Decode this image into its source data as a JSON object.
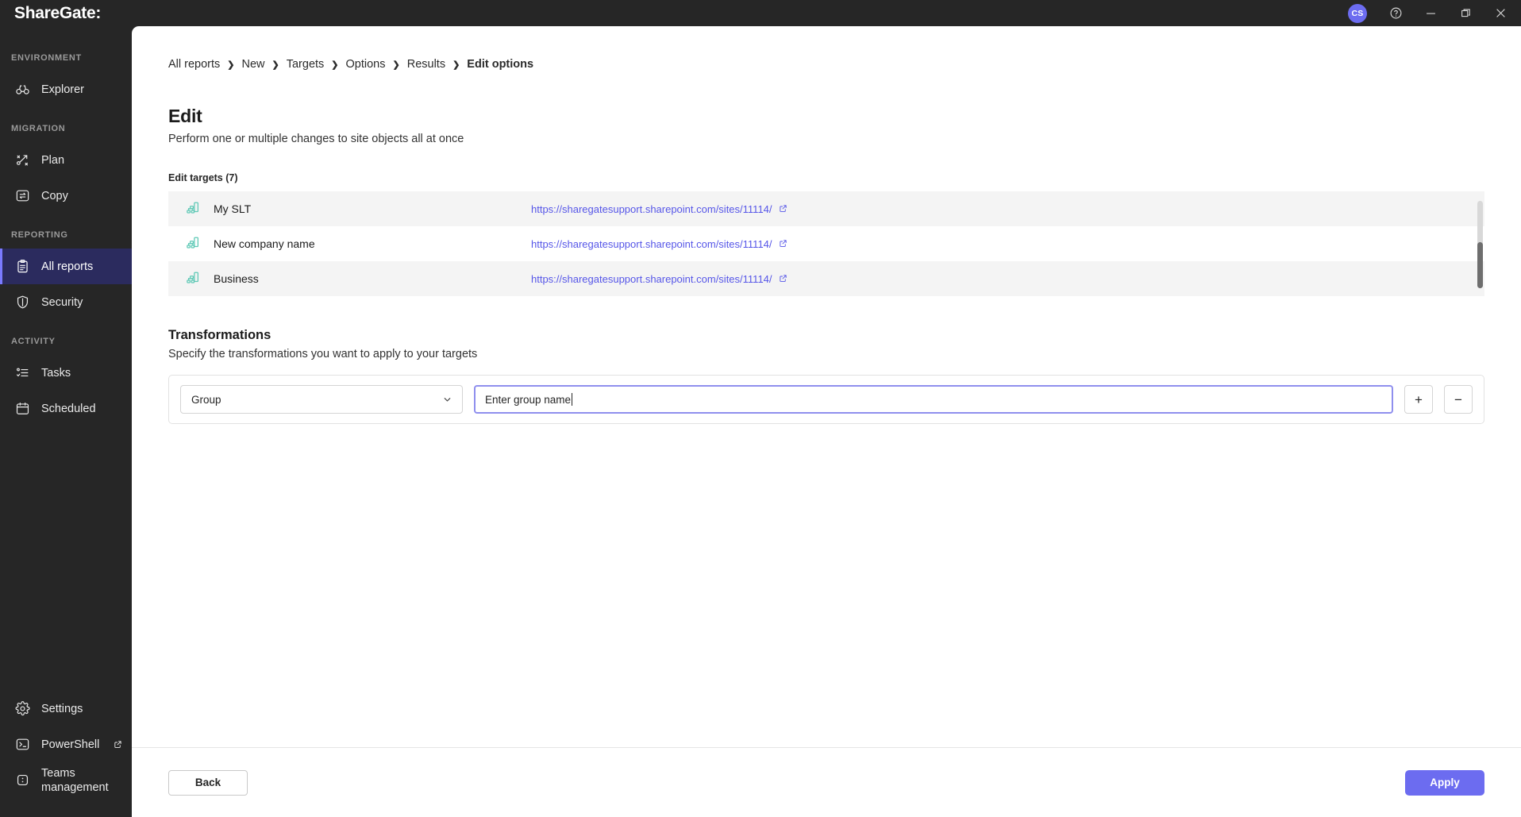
{
  "titlebar": {
    "brand": "ShareGate",
    "brand_suffix": ":",
    "avatar_initials": "CS",
    "help_label": "help-icon",
    "minimize_label": "Minimize",
    "maximize_label": "Maximize",
    "close_label": "Close"
  },
  "sidebar": {
    "sections": [
      {
        "label": "ENVIRONMENT",
        "items": [
          {
            "label": "Explorer",
            "icon": "binoculars-icon",
            "active": false,
            "external": false
          }
        ]
      },
      {
        "label": "MIGRATION",
        "items": [
          {
            "label": "Plan",
            "icon": "plan-icon",
            "active": false,
            "external": false
          },
          {
            "label": "Copy",
            "icon": "copy-icon",
            "active": false,
            "external": false
          }
        ]
      },
      {
        "label": "REPORTING",
        "items": [
          {
            "label": "All reports",
            "icon": "clipboard-icon",
            "active": true,
            "external": false
          },
          {
            "label": "Security",
            "icon": "shield-icon",
            "active": false,
            "external": false
          }
        ]
      },
      {
        "label": "ACTIVITY",
        "items": [
          {
            "label": "Tasks",
            "icon": "tasks-icon",
            "active": false,
            "external": false
          },
          {
            "label": "Scheduled",
            "icon": "calendar-icon",
            "active": false,
            "external": false
          }
        ]
      }
    ],
    "bottom_items": [
      {
        "label": "Settings",
        "icon": "gear-icon",
        "external": false
      },
      {
        "label": "PowerShell",
        "icon": "terminal-icon",
        "external": true
      },
      {
        "label": "Teams management",
        "icon": "teams-icon",
        "external": false
      }
    ]
  },
  "breadcrumb": [
    {
      "label": "All reports",
      "current": false
    },
    {
      "label": "New",
      "current": false
    },
    {
      "label": "Targets",
      "current": false
    },
    {
      "label": "Options",
      "current": false
    },
    {
      "label": "Results",
      "current": false
    },
    {
      "label": "Edit options",
      "current": true
    }
  ],
  "page": {
    "title": "Edit",
    "subtitle": "Perform one or multiple changes to site objects all at once",
    "targets_label": "Edit targets (7)",
    "targets": [
      {
        "name": "My SLT",
        "url": "https://sharegatesupport.sharepoint.com/sites/11114/",
        "icon": "site-icon"
      },
      {
        "name": "New company name",
        "url": "https://sharegatesupport.sharepoint.com/sites/11114/",
        "icon": "site-icon"
      },
      {
        "name": "Business",
        "url": "https://sharegatesupport.sharepoint.com/sites/11114/",
        "icon": "site-icon"
      }
    ],
    "transformations": {
      "title": "Transformations",
      "subtitle": "Specify the transformations you want to apply to your targets",
      "property_selected": "Group",
      "property_options": [
        "Group"
      ],
      "value_text": "Enter group name",
      "value_placeholder": "Enter group name",
      "add_label": "+",
      "remove_label": "−"
    }
  },
  "footer": {
    "back_label": "Back",
    "apply_label": "Apply"
  },
  "colors": {
    "chrome": "#262626",
    "accent": "#6c6cf0",
    "link": "#5656e8",
    "active_nav_bg": "#2b2b5e",
    "active_nav_bar": "#7a7aff",
    "target_icon": "#5fc9b6",
    "row_alt": "#f4f4f4"
  }
}
